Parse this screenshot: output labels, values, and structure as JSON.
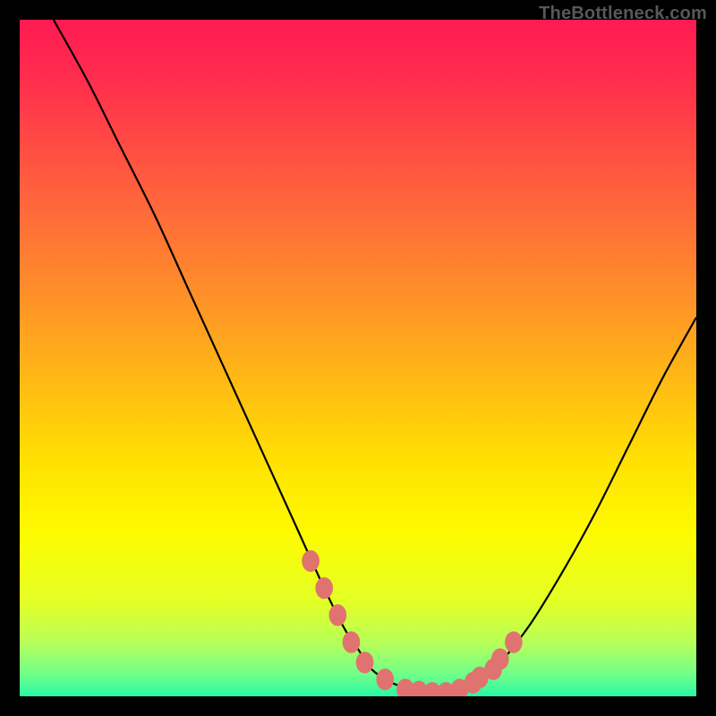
{
  "watermark": "TheBottleneck.com",
  "colors": {
    "background": "#000000",
    "gradient_stops": [
      {
        "offset": 0.0,
        "color": "#ff1a52"
      },
      {
        "offset": 0.08,
        "color": "#ff2b4e"
      },
      {
        "offset": 0.18,
        "color": "#ff4a44"
      },
      {
        "offset": 0.3,
        "color": "#ff6f38"
      },
      {
        "offset": 0.42,
        "color": "#ff9426"
      },
      {
        "offset": 0.55,
        "color": "#ffbf12"
      },
      {
        "offset": 0.66,
        "color": "#ffe300"
      },
      {
        "offset": 0.76,
        "color": "#fdfb00"
      },
      {
        "offset": 0.86,
        "color": "#e3ff25"
      },
      {
        "offset": 0.92,
        "color": "#b8ff58"
      },
      {
        "offset": 0.97,
        "color": "#6cff8b"
      },
      {
        "offset": 1.0,
        "color": "#28f7a6"
      }
    ],
    "curve": "#000000",
    "marker": "#e0736f"
  },
  "chart_data": {
    "type": "line",
    "title": "",
    "xlabel": "",
    "ylabel": "",
    "ylim": [
      0,
      100
    ],
    "xlim": [
      0,
      100
    ],
    "series": [
      {
        "name": "bottleneck_curve",
        "x": [
          5,
          10,
          15,
          20,
          25,
          30,
          35,
          40,
          45,
          48,
          50,
          52,
          55,
          58,
          60,
          63,
          65,
          70,
          75,
          80,
          85,
          90,
          95,
          100
        ],
        "y": [
          100,
          91,
          81,
          71,
          60,
          49,
          38,
          27,
          16,
          10,
          7,
          4,
          2,
          1,
          0.5,
          0.5,
          1,
          4,
          10,
          18,
          27,
          37,
          47,
          56
        ]
      }
    ],
    "markers": {
      "name": "highlighted_points",
      "x": [
        43,
        45,
        47,
        49,
        51,
        54,
        57,
        59,
        61,
        63,
        65,
        67,
        68,
        70,
        71,
        73
      ],
      "y": [
        20,
        16,
        12,
        8,
        5,
        2.5,
        1,
        0.7,
        0.5,
        0.5,
        1,
        2,
        2.8,
        4,
        5.5,
        8
      ]
    }
  }
}
